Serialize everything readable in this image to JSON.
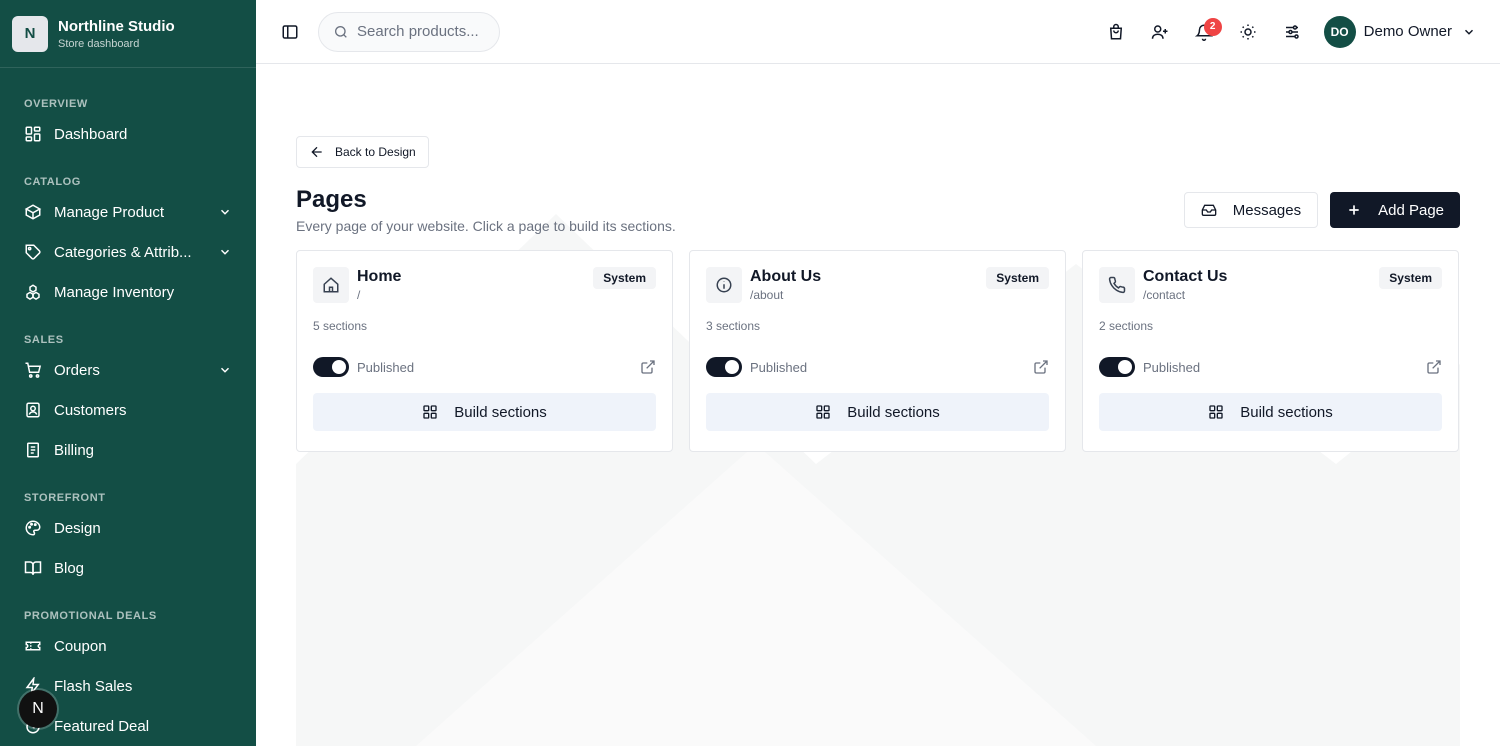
{
  "brand": {
    "logo_letter": "N",
    "name": "Northline Studio",
    "subtitle": "Store dashboard"
  },
  "sidebar": {
    "groups": [
      {
        "label": "OVERVIEW",
        "items": [
          {
            "label": "Dashboard",
            "icon": "dashboard-icon"
          }
        ]
      },
      {
        "label": "CATALOG",
        "items": [
          {
            "label": "Manage Product",
            "icon": "box-icon",
            "expandable": true
          },
          {
            "label": "Categories & Attrib...",
            "icon": "tag-icon",
            "expandable": true
          },
          {
            "label": "Manage Inventory",
            "icon": "inventory-icon"
          }
        ]
      },
      {
        "label": "SALES",
        "items": [
          {
            "label": "Orders",
            "icon": "cart-icon",
            "expandable": true
          },
          {
            "label": "Customers",
            "icon": "customers-icon"
          },
          {
            "label": "Billing",
            "icon": "billing-icon"
          }
        ]
      },
      {
        "label": "STOREFRONT",
        "items": [
          {
            "label": "Design",
            "icon": "palette-icon"
          },
          {
            "label": "Blog",
            "icon": "book-icon"
          }
        ]
      },
      {
        "label": "PROMOTIONAL DEALS",
        "items": [
          {
            "label": "Coupon",
            "icon": "ticket-icon"
          },
          {
            "label": "Flash Sales",
            "icon": "flash-icon"
          },
          {
            "label": "Featured Deal",
            "icon": "timer-icon"
          }
        ]
      }
    ],
    "floating_avatar": "N"
  },
  "header": {
    "search_placeholder": "Search products...",
    "notification_count": "2",
    "user_initials": "DO",
    "user_name": "Demo Owner"
  },
  "main": {
    "back_label": "Back to Design",
    "title": "Pages",
    "subtitle": "Every page of your website. Click a page to build its sections.",
    "messages_label": "Messages",
    "add_page_label": "Add Page",
    "cards": [
      {
        "title": "Home",
        "slug": "/",
        "badge": "System",
        "sections": "5 sections",
        "status": "Published",
        "build_label": "Build sections",
        "icon": "home-icon"
      },
      {
        "title": "About Us",
        "slug": "/about",
        "badge": "System",
        "sections": "3 sections",
        "status": "Published",
        "build_label": "Build sections",
        "icon": "info-icon"
      },
      {
        "title": "Contact Us",
        "slug": "/contact",
        "badge": "System",
        "sections": "2 sections",
        "status": "Published",
        "build_label": "Build sections",
        "icon": "phone-icon"
      }
    ]
  },
  "colors": {
    "sidebar_bg": "#134e45",
    "primary_button": "#111827",
    "badge": "#ef4444",
    "build_button_bg": "#eff3fa"
  }
}
